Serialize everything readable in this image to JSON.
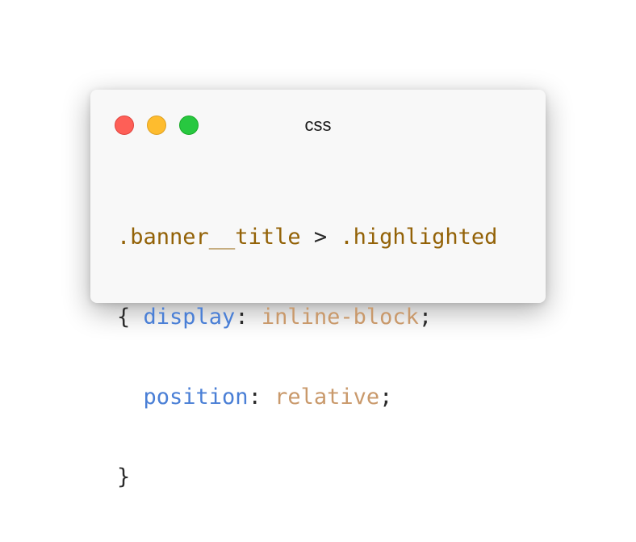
{
  "window": {
    "title": "css",
    "traffic_lights": [
      {
        "name": "close",
        "color": "#fe5f57",
        "border": "#e0443e"
      },
      {
        "name": "minimize",
        "color": "#febc2e",
        "border": "#dea123"
      },
      {
        "name": "zoom",
        "color": "#28c840",
        "border": "#1aab29"
      }
    ]
  },
  "colors": {
    "selector": "#936207",
    "property": "#4a7fd6",
    "value": "#c9996b",
    "punctuation": "#2b2b2b",
    "background": "#f8f8f8"
  },
  "code": {
    "line1": {
      "selector1": ".banner__title",
      "combinator": " > ",
      "selector2": ".highlighted"
    },
    "line2": {
      "brace_open": "{ ",
      "prop": "display",
      "colon": ": ",
      "value": "inline-block",
      "semicolon": ";"
    },
    "line3": {
      "indent": "  ",
      "prop": "position",
      "colon": ": ",
      "value": "relative",
      "semicolon": ";"
    },
    "line4": {
      "brace_close": "}"
    }
  }
}
